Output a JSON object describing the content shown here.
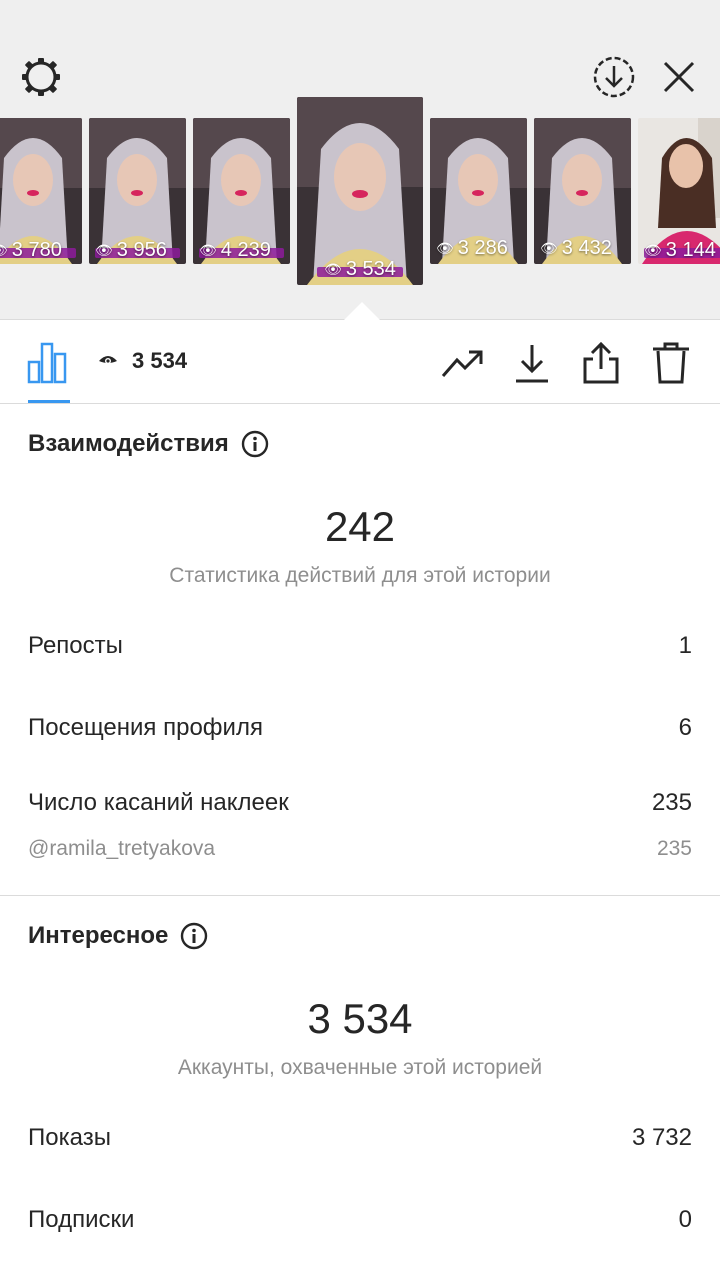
{
  "stories": [
    {
      "views": "3 780"
    },
    {
      "views": "3 956"
    },
    {
      "views": "4 239"
    },
    {
      "views": "3 534",
      "selected": true
    },
    {
      "views": "3 286"
    },
    {
      "views": "3 432"
    },
    {
      "views": "3 144"
    }
  ],
  "toolbar": {
    "views": "3 534"
  },
  "interactions": {
    "title": "Взаимодействия",
    "total": "242",
    "subtitle": "Статистика действий для этой истории",
    "rows": [
      {
        "label": "Репосты",
        "value": "1"
      },
      {
        "label": "Посещения профиля",
        "value": "6"
      },
      {
        "label": "Число касаний наклеек",
        "value": "235"
      }
    ],
    "sticker": {
      "label": "@ramila_tretyakova",
      "value": "235"
    }
  },
  "discovery": {
    "title": "Интересное",
    "total": "3 534",
    "subtitle": "Аккаунты, охваченные этой историей",
    "rows": [
      {
        "label": "Показы",
        "value": "3 732"
      },
      {
        "label": "Подписки",
        "value": "0"
      }
    ]
  },
  "colors": {
    "accent": "#3897f0",
    "tag": "#8d1b9b",
    "muted": "#8e8e8e"
  },
  "icons": [
    "settings-icon",
    "download-circle-icon",
    "close-icon",
    "bar-chart-icon",
    "eye-icon",
    "trend-icon",
    "download-icon",
    "share-icon",
    "trash-icon",
    "info-icon"
  ]
}
